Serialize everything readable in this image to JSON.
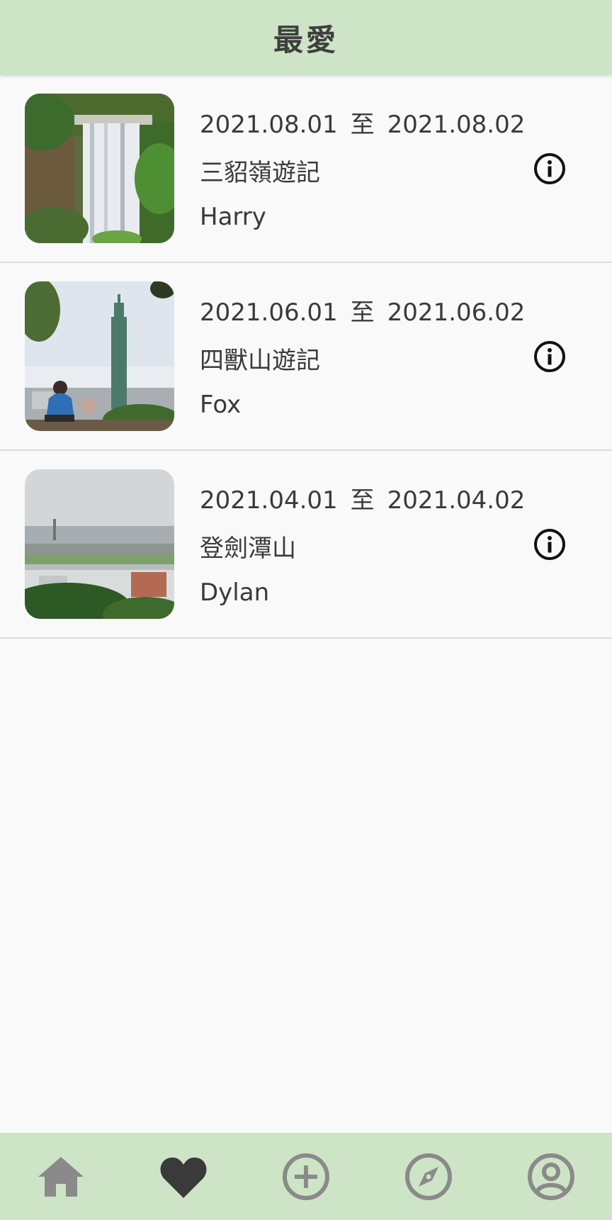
{
  "header": {
    "title": "最愛"
  },
  "items": [
    {
      "start": "2021.08.01",
      "sep": "至",
      "end": "2021.08.02",
      "title": "三貂嶺遊記",
      "author": "Harry",
      "image_icon": "waterfall-photo"
    },
    {
      "start": "2021.06.01",
      "sep": "至",
      "end": "2021.06.02",
      "title": "四獸山遊記",
      "author": "Fox",
      "image_icon": "taipei101-photo"
    },
    {
      "start": "2021.04.01",
      "sep": "至",
      "end": "2021.04.02",
      "title": "登劍潭山",
      "author": "Dylan",
      "image_icon": "city-view-photo"
    }
  ],
  "tabbar": {
    "tabs": [
      {
        "icon": "home-icon",
        "active": false
      },
      {
        "icon": "heart-icon",
        "active": true
      },
      {
        "icon": "add-circle-icon",
        "active": false
      },
      {
        "icon": "compass-icon",
        "active": false
      },
      {
        "icon": "account-icon",
        "active": false
      }
    ]
  },
  "colors": {
    "header_bg": "#cde5c6",
    "tabbar_bg": "#cde5c6",
    "inactive_icon": "#8a8a8a",
    "active_icon": "#3a3a3a"
  }
}
